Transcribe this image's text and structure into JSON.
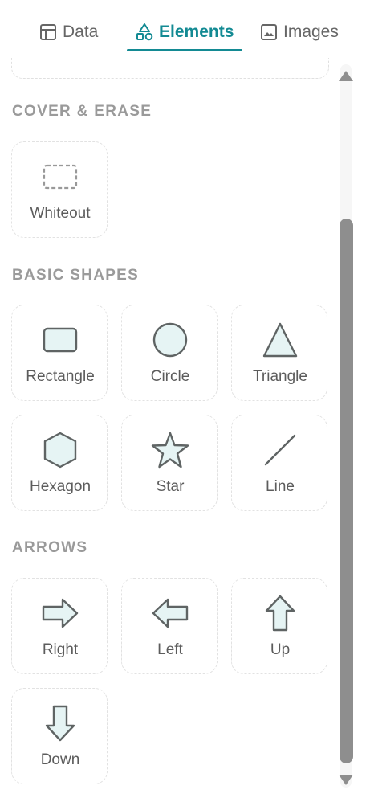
{
  "tabs": {
    "data_label": "Data",
    "elements_label": "Elements",
    "images_label": "Images"
  },
  "colors": {
    "accent": "#138a93",
    "shape_fill": "#e6f4f4",
    "shape_stroke": "#5f6464"
  },
  "sections": {
    "cover": {
      "title": "COVER & ERASE",
      "items": {
        "whiteout": "Whiteout"
      }
    },
    "basic": {
      "title": "BASIC SHAPES",
      "items": {
        "rectangle": "Rectangle",
        "circle": "Circle",
        "triangle": "Triangle",
        "hexagon": "Hexagon",
        "star": "Star",
        "line": "Line"
      }
    },
    "arrows": {
      "title": "ARROWS",
      "items": {
        "right": "Right",
        "left": "Left",
        "up": "Up",
        "down": "Down"
      }
    }
  }
}
